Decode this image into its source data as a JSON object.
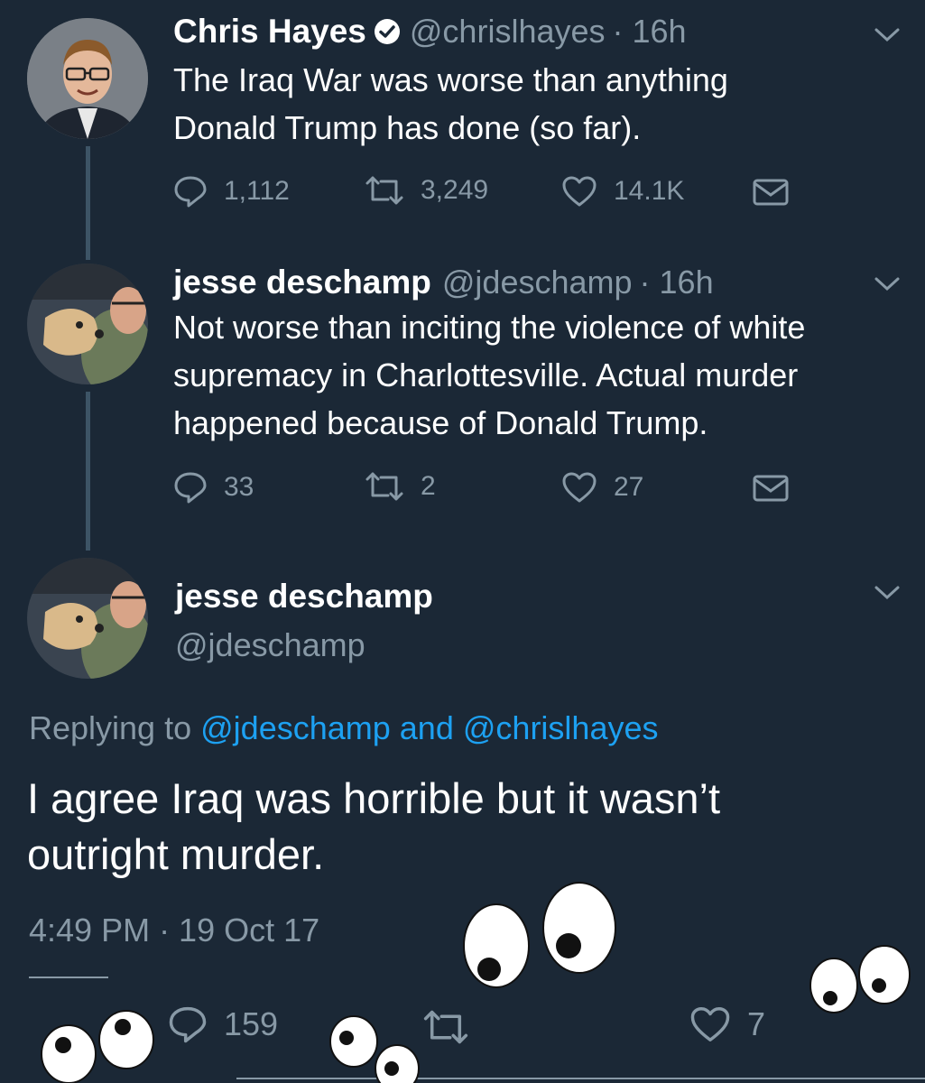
{
  "colors": {
    "background": "#1b2836",
    "text": "#ffffff",
    "muted": "#8899a6",
    "link": "#1da1f2"
  },
  "tweets": [
    {
      "name": "Chris Hayes",
      "verified": true,
      "handle": "@chrislhayes",
      "time": "· 16h",
      "text_lines": [
        "The Iraq War was worse than anything",
        "Donald Trump has done (so far)."
      ],
      "replies": "1,112",
      "retweets": "3,249",
      "likes": "14.1K"
    },
    {
      "name": "jesse deschamp",
      "handle": "@jdeschamp",
      "time": "· 16h",
      "text_lines": [
        "Not worse than inciting the violence of white",
        "supremacy in Charlottesville. Actual murder",
        "happened because of Donald Trump."
      ],
      "replies": "33",
      "retweets": "2",
      "likes": "27"
    }
  ],
  "main_tweet": {
    "name": "jesse deschamp",
    "handle": "@jdeschamp",
    "replying_label": "Replying to",
    "replying_user1": "@jdeschamp",
    "replying_and": "and",
    "replying_user2": "@chrislhayes",
    "text_lines": [
      "I agree Iraq was horrible but it wasn’t",
      "outright murder."
    ],
    "timestamp": "4:49 PM · 19 Oct 17",
    "replies": "159",
    "likes": "7"
  },
  "icons": [
    "verified-badge-icon",
    "reply-icon",
    "retweet-icon",
    "like-icon",
    "dm-icon",
    "chevron-down-icon"
  ]
}
